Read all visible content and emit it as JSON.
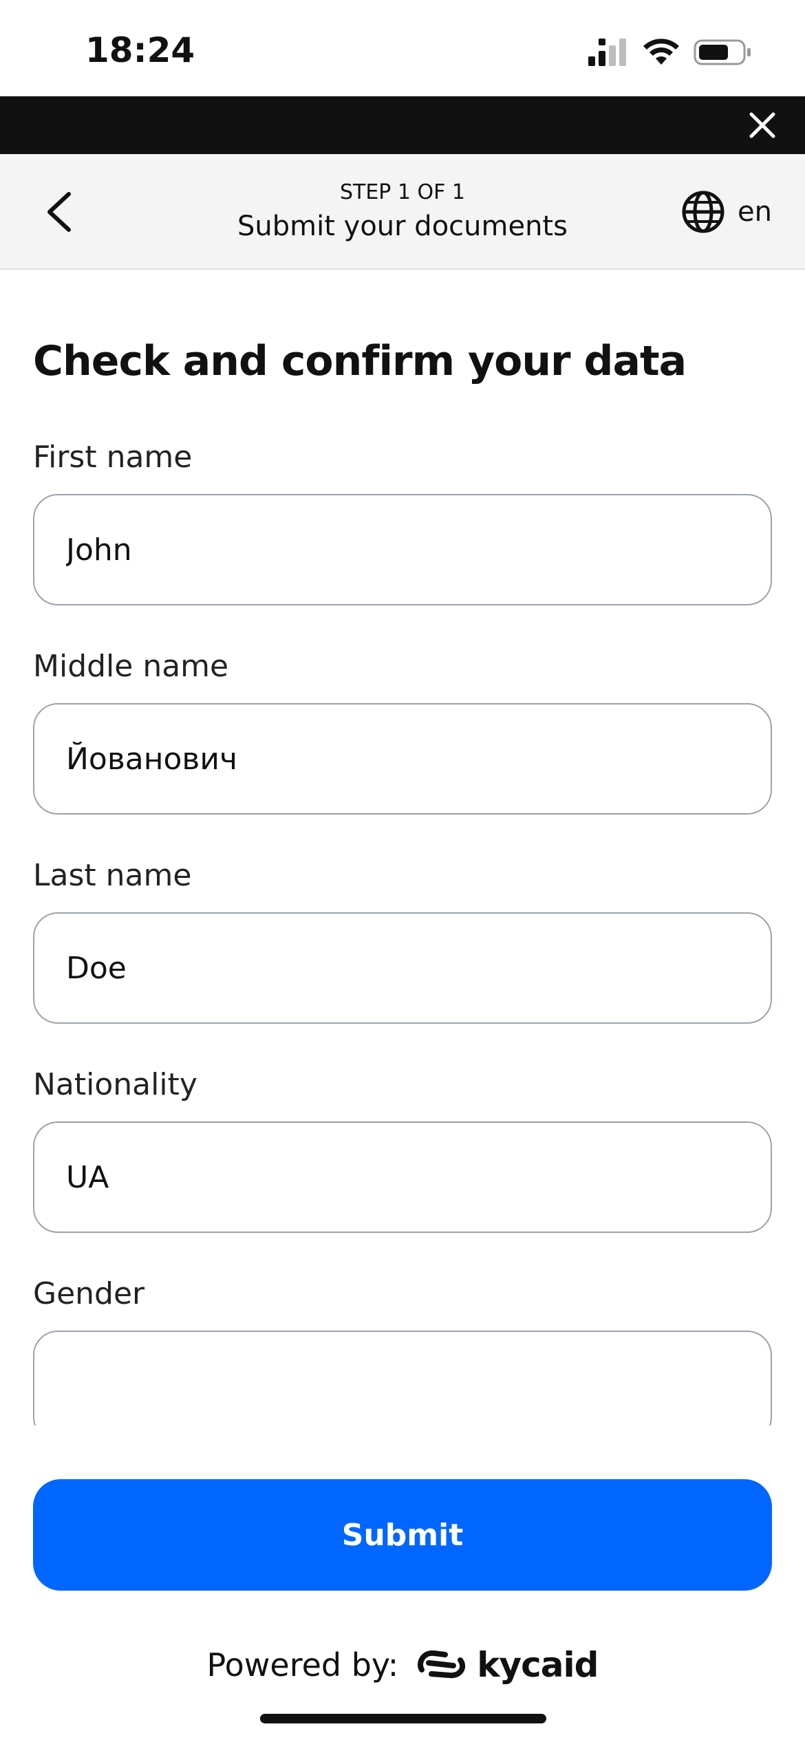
{
  "status_bar": {
    "time": "18:24"
  },
  "header": {
    "step_label": "STEP 1 OF 1",
    "title": "Submit your documents",
    "language": "en"
  },
  "form": {
    "title": "Check and confirm your data",
    "fields": [
      {
        "label": "First name",
        "value": "John"
      },
      {
        "label": "Middle name",
        "value": "Йованович"
      },
      {
        "label": "Last name",
        "value": "Doe"
      },
      {
        "label": "Nationality",
        "value": "UA"
      },
      {
        "label": "Gender",
        "value": ""
      }
    ]
  },
  "actions": {
    "submit_label": "Submit"
  },
  "footer": {
    "powered_by": "Powered by:",
    "brand": "kycaid"
  },
  "colors": {
    "accent": "#0066ff",
    "strip": "#111111",
    "header_bg": "#f4f4f4"
  },
  "icons": [
    "signal-icon",
    "wifi-icon",
    "battery-icon",
    "close-icon",
    "back-chevron-icon",
    "globe-icon",
    "kycaid-logo-icon"
  ]
}
